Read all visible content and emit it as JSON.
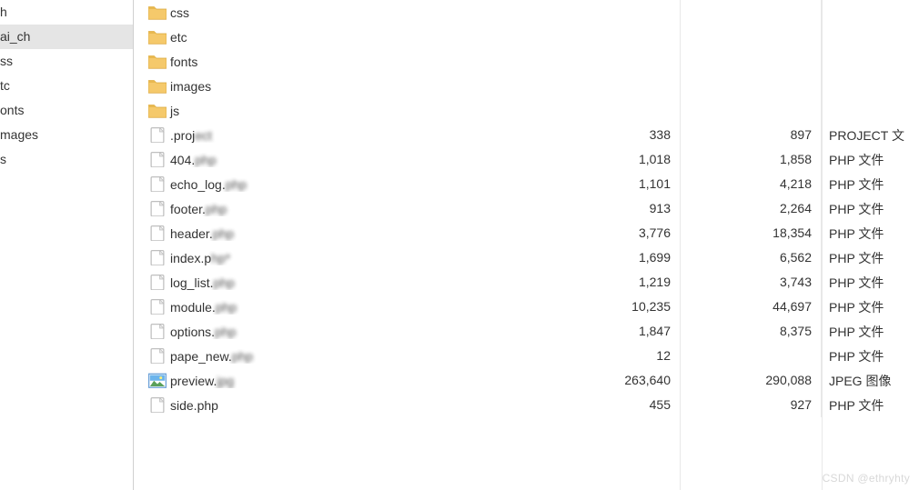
{
  "sidebar": {
    "items": [
      {
        "label": "h",
        "selected": false
      },
      {
        "label": "ai_ch",
        "selected": true
      },
      {
        "label": "ss",
        "selected": false
      },
      {
        "label": "tc",
        "selected": false
      },
      {
        "label": "onts",
        "selected": false
      },
      {
        "label": "mages",
        "selected": false
      },
      {
        "label": "s",
        "selected": false
      }
    ]
  },
  "files": [
    {
      "icon": "folder",
      "name": "css",
      "size1": "",
      "size2": "",
      "type": ""
    },
    {
      "icon": "folder",
      "name": "etc",
      "size1": "",
      "size2": "",
      "type": ""
    },
    {
      "icon": "folder",
      "name": "fonts",
      "size1": "",
      "size2": "",
      "type": ""
    },
    {
      "icon": "folder",
      "name": "images",
      "size1": "",
      "size2": "",
      "type": ""
    },
    {
      "icon": "folder",
      "name": "js",
      "size1": "",
      "size2": "",
      "type": ""
    },
    {
      "icon": "file",
      "name": ".project",
      "blurTail": true,
      "size1": "338",
      "size2": "897",
      "type": "PROJECT 文"
    },
    {
      "icon": "file",
      "name": "404.php",
      "blurTail": true,
      "size1": "1,018",
      "size2": "1,858",
      "type": "PHP 文件"
    },
    {
      "icon": "file",
      "name": "echo_log.php",
      "blurTail": true,
      "size1": "1,101",
      "size2": "4,218",
      "type": "PHP 文件"
    },
    {
      "icon": "file",
      "name": "footer.php",
      "blurTail": true,
      "size1": "913",
      "size2": "2,264",
      "type": "PHP 文件"
    },
    {
      "icon": "file",
      "name": "header.php",
      "blurTail": true,
      "size1": "3,776",
      "size2": "18,354",
      "type": "PHP 文件"
    },
    {
      "icon": "file",
      "name": "index.php*",
      "blurTail": true,
      "size1": "1,699",
      "size2": "6,562",
      "type": "PHP 文件"
    },
    {
      "icon": "file",
      "name": "log_list.php",
      "blurTail": true,
      "size1": "1,219",
      "size2": "3,743",
      "type": "PHP 文件"
    },
    {
      "icon": "file",
      "name": "module.php",
      "blurTail": true,
      "size1": "10,235",
      "size2": "44,697",
      "type": "PHP 文件"
    },
    {
      "icon": "file",
      "name": "options.php",
      "blurTail": true,
      "size1": "1,847",
      "size2": "8,375",
      "type": "PHP 文件"
    },
    {
      "icon": "file",
      "name": "pape_new.php",
      "blurTail": true,
      "size1": "12",
      "size2": "",
      "type": "PHP 文件"
    },
    {
      "icon": "image",
      "name": "preview.jpg",
      "blurTail": true,
      "size1": "263,640",
      "size2": "290,088",
      "type": "JPEG 图像"
    },
    {
      "icon": "file",
      "name": "side.php",
      "size1": "455",
      "size2": "927",
      "type": "PHP 文件"
    }
  ],
  "watermark": "CSDN @ethryhty"
}
